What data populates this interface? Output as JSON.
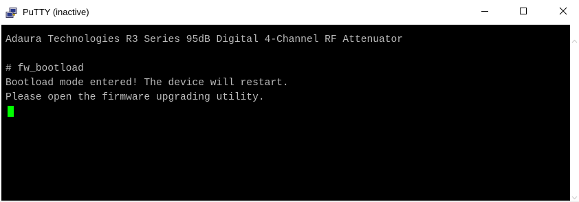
{
  "window": {
    "title": "PuTTY (inactive)",
    "app_icon": "putty-computers-icon"
  },
  "controls": {
    "minimize_icon": "minimize-icon",
    "maximize_icon": "maximize-icon",
    "close_icon": "close-icon"
  },
  "terminal": {
    "lines": [
      "Adaura Technologies R3 Series 95dB Digital 4-Channel RF Attenuator",
      "",
      "# fw_bootload",
      "Bootload mode entered! The device will restart.",
      "Please open the firmware upgrading utility."
    ],
    "text_color": "#bbbbbb",
    "background": "#000000",
    "cursor_color": "#00ff00"
  }
}
